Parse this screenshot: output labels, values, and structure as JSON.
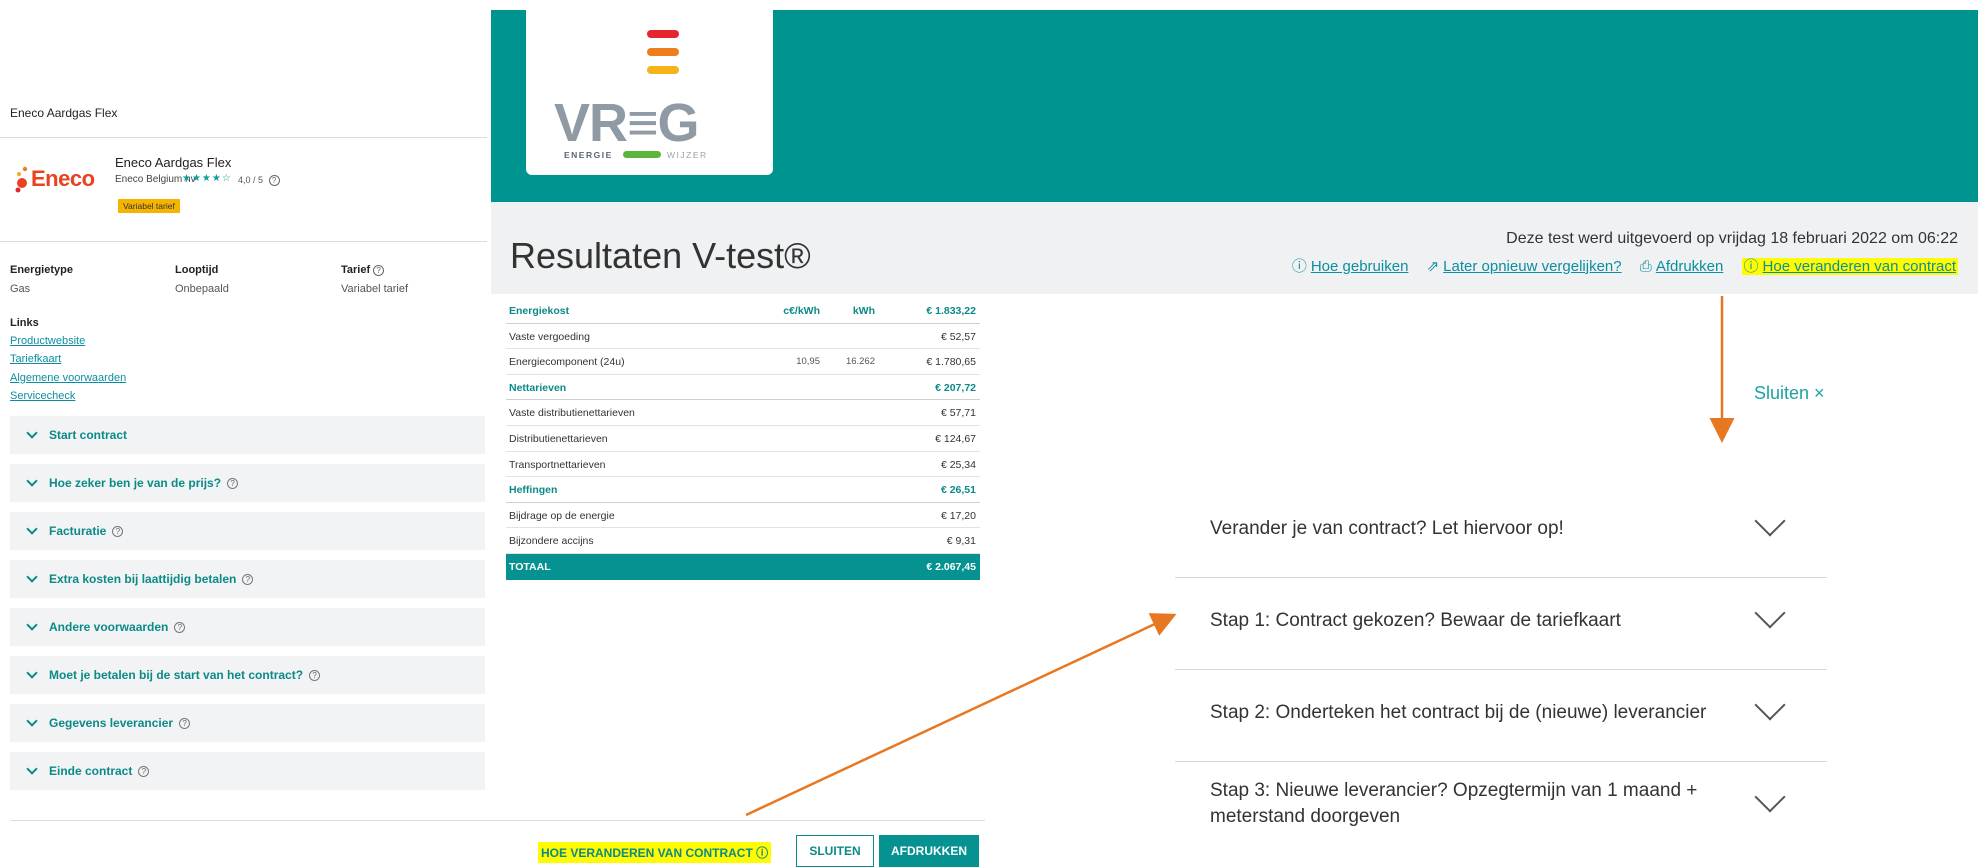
{
  "left_panel": {
    "header_title": "Eneco Aardgas Flex",
    "logo_text": "Eneco",
    "product_name": "Eneco Aardgas Flex",
    "company": "Eneco Belgium nv",
    "stars": "★★★★☆",
    "rating": "4,0 / 5",
    "tariff_badge": "Variabel tarief",
    "attributes": [
      {
        "label": "Energietype",
        "value": "Gas"
      },
      {
        "label": "Looptijd",
        "value": "Onbepaald"
      },
      {
        "label": "Tarief",
        "value": "Variabel tarief"
      }
    ],
    "links_title": "Links",
    "links": [
      "Productwebsite",
      "Tariefkaart",
      "Algemene voorwaarden",
      "Servicecheck"
    ],
    "accordion": [
      {
        "label": "Start contract",
        "help": false
      },
      {
        "label": "Hoe zeker ben je van de prijs?",
        "help": true
      },
      {
        "label": "Facturatie",
        "help": true
      },
      {
        "label": "Extra kosten bij laattijdig betalen",
        "help": true
      },
      {
        "label": "Andere voorwaarden",
        "help": true
      },
      {
        "label": "Moet je betalen bij de start van het contract?",
        "help": true
      },
      {
        "label": "Gegevens leverancier",
        "help": true
      },
      {
        "label": "Einde contract",
        "help": true
      }
    ],
    "help_glyph": "?"
  },
  "brand": {
    "logo_text": "VR≡G",
    "sub_left": "ENERGIE",
    "sub_right": "WIJZER",
    "bar_colors": [
      "#e4262f",
      "#f07d1b",
      "#f6b418"
    ],
    "teal": "#009491"
  },
  "header": {
    "title": "Resultaten V-test®",
    "date_text": "Deze test werd uitgevoerd op vrijdag 18 februari 2022 om 06:22",
    "links": [
      {
        "icon": "help-icon",
        "glyph": "ⓘ",
        "label": "Hoe gebruiken",
        "highlighted": false
      },
      {
        "icon": "share-icon",
        "glyph": "⇗",
        "label": "Later opnieuw vergelijken?",
        "highlighted": false
      },
      {
        "icon": "print-icon",
        "glyph": "⎙",
        "label": "Afdrukken",
        "highlighted": false
      },
      {
        "icon": "help-icon",
        "glyph": "ⓘ",
        "label": "Hoe veranderen van contract",
        "highlighted": true
      }
    ]
  },
  "cost_table": {
    "columns": [
      "c€/kWh",
      "kWh"
    ],
    "rows": [
      {
        "type": "hdr",
        "label": "Energiekost",
        "ckwh": "c€/kWh",
        "kwh": "kWh",
        "total": "€ 1.833,22"
      },
      {
        "type": "row",
        "label": "Vaste vergoeding",
        "ckwh": "",
        "kwh": "",
        "total": "€ 52,57"
      },
      {
        "type": "row",
        "label": "Energiecomponent (24u)",
        "ckwh": "10,95",
        "kwh": "16.262",
        "total": "€ 1.780,65"
      },
      {
        "type": "hdr",
        "label": "Nettarieven",
        "ckwh": "",
        "kwh": "",
        "total": "€ 207,72"
      },
      {
        "type": "row",
        "label": "Vaste distributienettarieven",
        "ckwh": "",
        "kwh": "",
        "total": "€ 57,71"
      },
      {
        "type": "row",
        "label": "Distributienettarieven",
        "ckwh": "",
        "kwh": "",
        "total": "€ 124,67"
      },
      {
        "type": "row",
        "label": "Transportnettarieven",
        "ckwh": "",
        "kwh": "",
        "total": "€ 25,34"
      },
      {
        "type": "hdr",
        "label": "Heffingen",
        "ckwh": "",
        "kwh": "",
        "total": "€ 26,51"
      },
      {
        "type": "row",
        "label": "Bijdrage op de energie",
        "ckwh": "",
        "kwh": "",
        "total": "€ 17,20"
      },
      {
        "type": "row",
        "label": "Bijzondere accijns",
        "ckwh": "",
        "kwh": "",
        "total": "€ 9,31"
      },
      {
        "type": "total",
        "label": "TOTAAL",
        "ckwh": "",
        "kwh": "",
        "total": "€ 2.067,45"
      }
    ]
  },
  "bottom_buttons": {
    "hoe_label": "HOE VERANDEREN VAN CONTRACT",
    "hoe_glyph": "ⓘ",
    "sluiten_label": "SLUITEN",
    "afdrukken_label": "AFDRUKKEN"
  },
  "callout": {
    "close_label": "Sluiten ×",
    "steps": [
      "Verander je van contract? Let hiervoor op!",
      "Stap 1: Contract gekozen? Bewaar de tariefkaart",
      "Stap 2: Onderteken het contract bij de (nieuwe) leverancier",
      "Stap 3: Nieuwe leverancier? Opzegtermijn van 1 maand + meterstand doorgeven"
    ],
    "arrow_color": "#e87722",
    "highlight_color": "#fffb00"
  }
}
